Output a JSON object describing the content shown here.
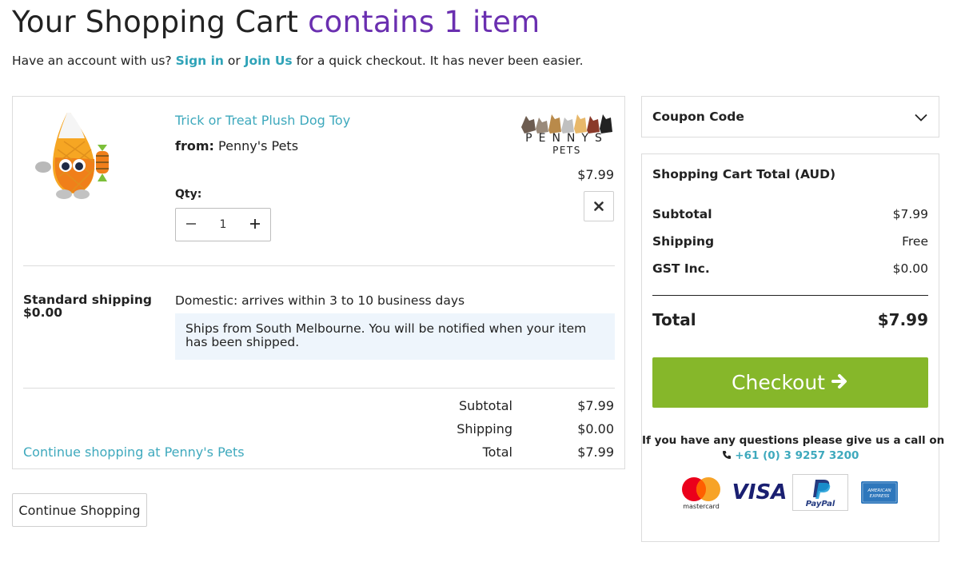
{
  "header": {
    "title_main": "Your Shopping Cart",
    "title_accent": "contains 1 item",
    "account_prefix": "Have an account with us?",
    "sign_in": "Sign in",
    "or_text": "or",
    "join_us": "Join Us",
    "account_suffix": "for a quick checkout. It has never been easier."
  },
  "cart_item": {
    "name": "Trick or Treat Plush Dog Toy",
    "from_label": "from:",
    "seller": "Penny's Pets",
    "price": "$7.99",
    "qty_label": "Qty:",
    "qty": "1",
    "brand_logo_text": "PENNYS",
    "brand_logo_sub": "PETS"
  },
  "shipping": {
    "method": "Standard shipping",
    "method_cost": "$0.00",
    "description": "Domestic: arrives within 3 to 10 business days",
    "note": "Ships from South Melbourne. You will be notified when your item has been shipped."
  },
  "seller_summary": {
    "subtotal_label": "Subtotal",
    "subtotal_value": "$7.99",
    "shipping_label": "Shipping",
    "shipping_value": "$0.00",
    "total_label": "Total",
    "total_value": "$7.99",
    "continue_link": "Continue shopping at Penny's Pets"
  },
  "continue_button": "Continue Shopping",
  "coupon": {
    "label": "Coupon Code"
  },
  "totals": {
    "title": "Shopping Cart Total (AUD)",
    "subtotal_label": "Subtotal",
    "subtotal_value": "$7.99",
    "shipping_label": "Shipping",
    "shipping_value": "Free",
    "gst_label": "GST Inc.",
    "gst_value": "$0.00",
    "total_label": "Total",
    "total_value": "$7.99",
    "checkout_label": "Checkout",
    "help_text": "If you have any questions please give us a call on",
    "phone": "+61 (0) 3 9257 3200"
  },
  "payment_methods": {
    "mastercard": "mastercard",
    "visa": "VISA",
    "paypal": "PayPal",
    "amex_line1": "AMERICAN",
    "amex_line2": "EXPRESS"
  },
  "colors": {
    "accent_purple": "#6a2fb0",
    "link_teal": "#3ea9bd",
    "checkout_green": "#86b72a",
    "note_bg": "#eef5fc"
  },
  "icons": [
    "minus-icon",
    "plus-icon",
    "close-icon",
    "chevron-down-icon",
    "arrow-right-icon",
    "phone-icon"
  ]
}
